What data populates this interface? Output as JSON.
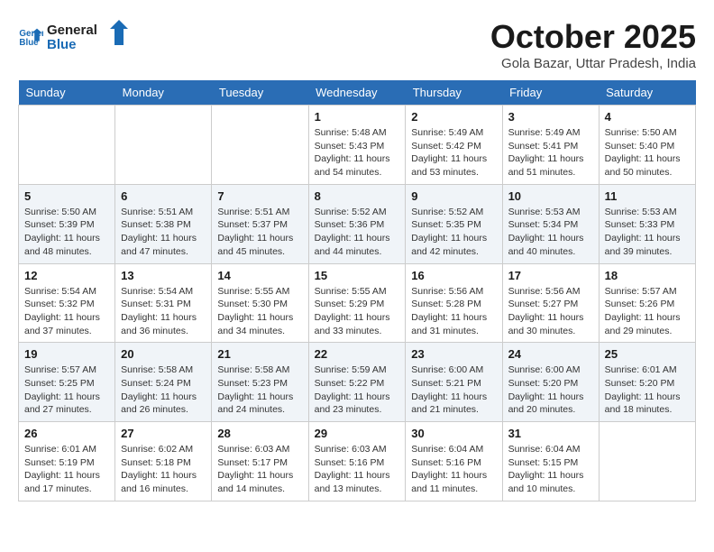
{
  "header": {
    "logo_line1": "General",
    "logo_line2": "Blue",
    "month_title": "October 2025",
    "location": "Gola Bazar, Uttar Pradesh, India"
  },
  "days_of_week": [
    "Sunday",
    "Monday",
    "Tuesday",
    "Wednesday",
    "Thursday",
    "Friday",
    "Saturday"
  ],
  "weeks": [
    [
      {
        "day": "",
        "info": ""
      },
      {
        "day": "",
        "info": ""
      },
      {
        "day": "",
        "info": ""
      },
      {
        "day": "1",
        "info": "Sunrise: 5:48 AM\nSunset: 5:43 PM\nDaylight: 11 hours and 54 minutes."
      },
      {
        "day": "2",
        "info": "Sunrise: 5:49 AM\nSunset: 5:42 PM\nDaylight: 11 hours and 53 minutes."
      },
      {
        "day": "3",
        "info": "Sunrise: 5:49 AM\nSunset: 5:41 PM\nDaylight: 11 hours and 51 minutes."
      },
      {
        "day": "4",
        "info": "Sunrise: 5:50 AM\nSunset: 5:40 PM\nDaylight: 11 hours and 50 minutes."
      }
    ],
    [
      {
        "day": "5",
        "info": "Sunrise: 5:50 AM\nSunset: 5:39 PM\nDaylight: 11 hours and 48 minutes."
      },
      {
        "day": "6",
        "info": "Sunrise: 5:51 AM\nSunset: 5:38 PM\nDaylight: 11 hours and 47 minutes."
      },
      {
        "day": "7",
        "info": "Sunrise: 5:51 AM\nSunset: 5:37 PM\nDaylight: 11 hours and 45 minutes."
      },
      {
        "day": "8",
        "info": "Sunrise: 5:52 AM\nSunset: 5:36 PM\nDaylight: 11 hours and 44 minutes."
      },
      {
        "day": "9",
        "info": "Sunrise: 5:52 AM\nSunset: 5:35 PM\nDaylight: 11 hours and 42 minutes."
      },
      {
        "day": "10",
        "info": "Sunrise: 5:53 AM\nSunset: 5:34 PM\nDaylight: 11 hours and 40 minutes."
      },
      {
        "day": "11",
        "info": "Sunrise: 5:53 AM\nSunset: 5:33 PM\nDaylight: 11 hours and 39 minutes."
      }
    ],
    [
      {
        "day": "12",
        "info": "Sunrise: 5:54 AM\nSunset: 5:32 PM\nDaylight: 11 hours and 37 minutes."
      },
      {
        "day": "13",
        "info": "Sunrise: 5:54 AM\nSunset: 5:31 PM\nDaylight: 11 hours and 36 minutes."
      },
      {
        "day": "14",
        "info": "Sunrise: 5:55 AM\nSunset: 5:30 PM\nDaylight: 11 hours and 34 minutes."
      },
      {
        "day": "15",
        "info": "Sunrise: 5:55 AM\nSunset: 5:29 PM\nDaylight: 11 hours and 33 minutes."
      },
      {
        "day": "16",
        "info": "Sunrise: 5:56 AM\nSunset: 5:28 PM\nDaylight: 11 hours and 31 minutes."
      },
      {
        "day": "17",
        "info": "Sunrise: 5:56 AM\nSunset: 5:27 PM\nDaylight: 11 hours and 30 minutes."
      },
      {
        "day": "18",
        "info": "Sunrise: 5:57 AM\nSunset: 5:26 PM\nDaylight: 11 hours and 29 minutes."
      }
    ],
    [
      {
        "day": "19",
        "info": "Sunrise: 5:57 AM\nSunset: 5:25 PM\nDaylight: 11 hours and 27 minutes."
      },
      {
        "day": "20",
        "info": "Sunrise: 5:58 AM\nSunset: 5:24 PM\nDaylight: 11 hours and 26 minutes."
      },
      {
        "day": "21",
        "info": "Sunrise: 5:58 AM\nSunset: 5:23 PM\nDaylight: 11 hours and 24 minutes."
      },
      {
        "day": "22",
        "info": "Sunrise: 5:59 AM\nSunset: 5:22 PM\nDaylight: 11 hours and 23 minutes."
      },
      {
        "day": "23",
        "info": "Sunrise: 6:00 AM\nSunset: 5:21 PM\nDaylight: 11 hours and 21 minutes."
      },
      {
        "day": "24",
        "info": "Sunrise: 6:00 AM\nSunset: 5:20 PM\nDaylight: 11 hours and 20 minutes."
      },
      {
        "day": "25",
        "info": "Sunrise: 6:01 AM\nSunset: 5:20 PM\nDaylight: 11 hours and 18 minutes."
      }
    ],
    [
      {
        "day": "26",
        "info": "Sunrise: 6:01 AM\nSunset: 5:19 PM\nDaylight: 11 hours and 17 minutes."
      },
      {
        "day": "27",
        "info": "Sunrise: 6:02 AM\nSunset: 5:18 PM\nDaylight: 11 hours and 16 minutes."
      },
      {
        "day": "28",
        "info": "Sunrise: 6:03 AM\nSunset: 5:17 PM\nDaylight: 11 hours and 14 minutes."
      },
      {
        "day": "29",
        "info": "Sunrise: 6:03 AM\nSunset: 5:16 PM\nDaylight: 11 hours and 13 minutes."
      },
      {
        "day": "30",
        "info": "Sunrise: 6:04 AM\nSunset: 5:16 PM\nDaylight: 11 hours and 11 minutes."
      },
      {
        "day": "31",
        "info": "Sunrise: 6:04 AM\nSunset: 5:15 PM\nDaylight: 11 hours and 10 minutes."
      },
      {
        "day": "",
        "info": ""
      }
    ]
  ]
}
